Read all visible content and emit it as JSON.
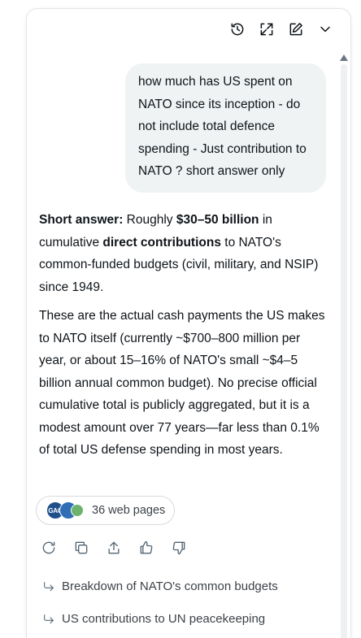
{
  "toolbar": {
    "history_icon": "history-icon",
    "expand_icon": "expand-icon",
    "edit_icon": "edit-icon",
    "collapse_icon": "chevron-down-icon"
  },
  "user_message": "how much has US spent on NATO since its inception - do not include total defence spending - Just contribution to NATO   ? short answer only",
  "answer": {
    "p1": {
      "lead": "Short answer:",
      "t1": " Roughly ",
      "amount": "$30–50 billion",
      "t2": " in cumulative ",
      "emph": "direct contributions",
      "t3": " to NATO's common-funded budgets (civil, military, and NSIP) since 1949."
    },
    "p2": "These are the actual cash payments the US makes to NATO itself (currently ~$700–800 million per year, or about 15–16% of NATO's small ~$4–5 billion annual common budget). No precise official cumulative total is publicly aggregated, but it is a modest amount over 77 years—far less than 0.1% of total US defense spending in most years."
  },
  "sources": {
    "favicon_label": "GAO",
    "label": "36 web pages"
  },
  "actions": [
    "regenerate-icon",
    "copy-icon",
    "share-icon",
    "thumbs-up-icon",
    "thumbs-down-icon"
  ],
  "suggestions": [
    "Breakdown of NATO's common budgets",
    "US contributions to UN peacekeeping"
  ]
}
